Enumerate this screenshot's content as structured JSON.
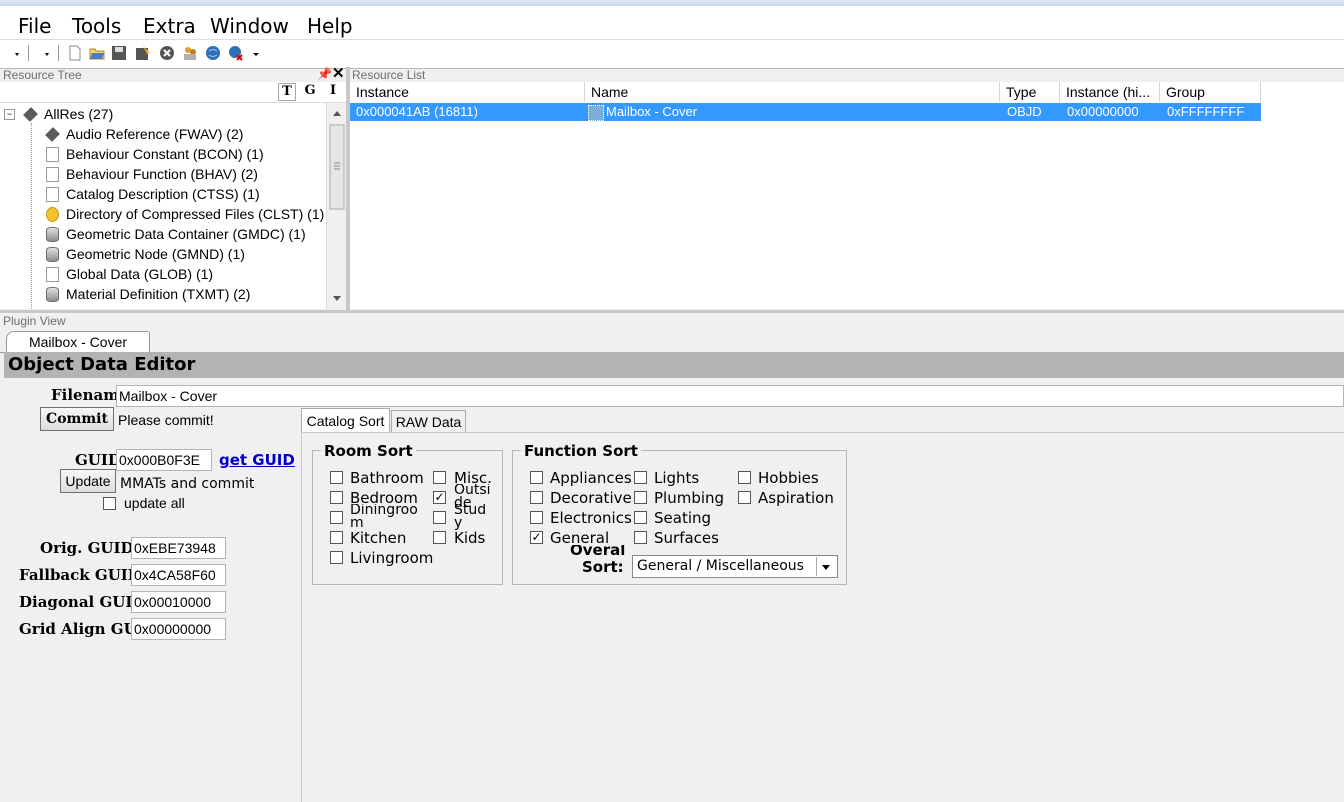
{
  "menu": [
    "File",
    "Tools",
    "Extra",
    "Window",
    "Help"
  ],
  "resource_tree": {
    "title": "Resource Tree",
    "tgi_buttons": [
      "T",
      "G",
      "I"
    ],
    "root": "AllRes (27)",
    "items": [
      {
        "label": "Audio Reference (FWAV) (2)",
        "icon": "cube-icon"
      },
      {
        "label": "Behaviour Constant (BCON) (1)",
        "icon": "document-icon"
      },
      {
        "label": "Behaviour Function (BHAV) (2)",
        "icon": "document-icon"
      },
      {
        "label": "Catalog Description (CTSS) (1)",
        "icon": "document-icon"
      },
      {
        "label": "Directory of Compressed Files (CLST) (1)",
        "icon": "star-icon"
      },
      {
        "label": "Geometric Data Container (GMDC) (1)",
        "icon": "database-icon"
      },
      {
        "label": "Geometric Node (GMND) (1)",
        "icon": "database-icon"
      },
      {
        "label": "Global Data (GLOB) (1)",
        "icon": "document-icon"
      },
      {
        "label": "Material Definition (TXMT) (2)",
        "icon": "database-icon"
      }
    ]
  },
  "resource_list": {
    "title": "Resource List",
    "columns": [
      "Instance",
      "Name",
      "Type",
      "Instance (hi...",
      "Group"
    ],
    "rows": [
      {
        "instance": "0x000041AB (16811)",
        "name": "Mailbox - Cover",
        "type": "OBJD",
        "instance_hi": "0x00000000",
        "group": "0xFFFFFFFF"
      }
    ]
  },
  "plugin_view": {
    "title": "Plugin View",
    "tab": "Mailbox - Cover",
    "editor_title": "Object Data Editor",
    "filename_label": "Filename",
    "filename_value": "Mailbox - Cover",
    "commit_label": "Commit",
    "commit_status": "Please commit!",
    "guid_label": "GUID",
    "guid_value": "0x000B0F3E",
    "get_guid": "get GUID",
    "update_label": "Update",
    "mmats_text": "MMATs and commit",
    "update_all": "update all",
    "orig_guid_label": "Orig. GUID",
    "orig_guid_value": "0xEBE73948",
    "fallback_guid_label": "Fallback GUID",
    "fallback_guid_value": "0x4CA58F60",
    "diagonal_guid_label": "Diagonal GUID",
    "diagonal_guid_value": "0x00010000",
    "grid_align_label": "Grid Align GUID",
    "grid_align_value": "0x00000000",
    "tabs": [
      "Catalog Sort",
      "RAW Data"
    ],
    "room_sort": {
      "title": "Room Sort",
      "items": [
        {
          "label": "Bathroom",
          "checked": false
        },
        {
          "label": "Misc.",
          "checked": false
        },
        {
          "label": "Bedroom",
          "checked": false
        },
        {
          "label": "Outside",
          "checked": true
        },
        {
          "label": "Diningroom",
          "checked": false
        },
        {
          "label": "Study",
          "checked": false
        },
        {
          "label": "Kitchen",
          "checked": false
        },
        {
          "label": "Kids",
          "checked": false
        },
        {
          "label": "Livingroom",
          "checked": false
        }
      ]
    },
    "function_sort": {
      "title": "Function Sort",
      "items": [
        {
          "label": "Appliances",
          "checked": false
        },
        {
          "label": "Lights",
          "checked": false
        },
        {
          "label": "Hobbies",
          "checked": false
        },
        {
          "label": "Decorative",
          "checked": false
        },
        {
          "label": "Plumbing",
          "checked": false
        },
        {
          "label": "Aspiration",
          "checked": false
        },
        {
          "label": "Electronics",
          "checked": false
        },
        {
          "label": "Seating",
          "checked": false
        },
        {
          "label": "General",
          "checked": true
        },
        {
          "label": "Surfaces",
          "checked": false
        }
      ],
      "overall_label_1": "Overall",
      "overall_label_2": "Sort:",
      "overall_value": "General / Miscellaneous"
    }
  },
  "colors": {
    "selection": "#3399ff",
    "link": "#0000cc"
  }
}
